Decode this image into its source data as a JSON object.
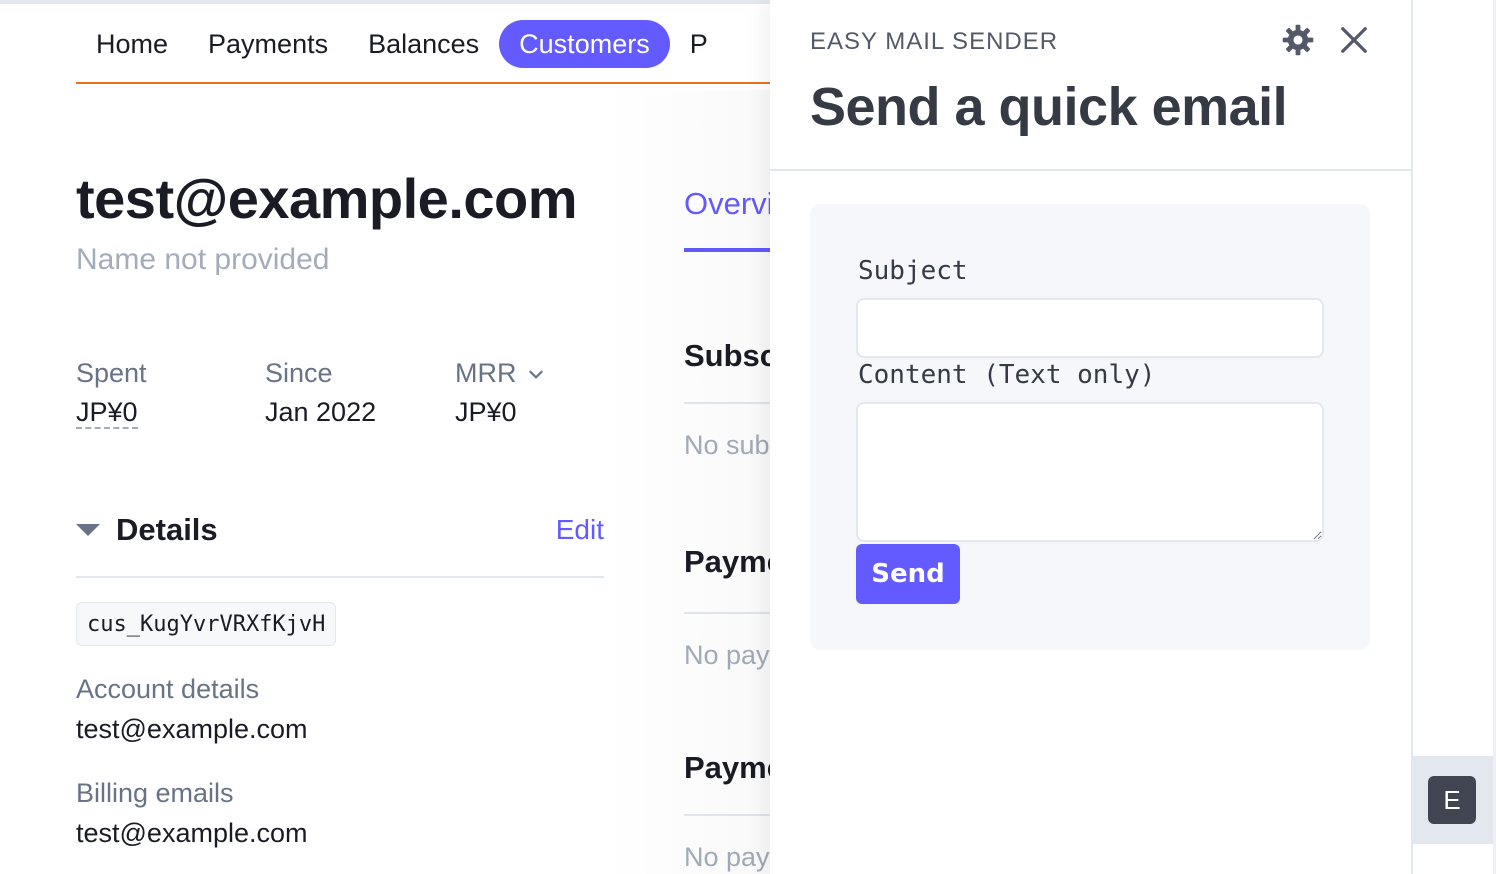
{
  "nav": {
    "items": [
      {
        "label": "Home",
        "active": false
      },
      {
        "label": "Payments",
        "active": false
      },
      {
        "label": "Balances",
        "active": false
      },
      {
        "label": "Customers",
        "active": true
      },
      {
        "label": "P",
        "active": false
      }
    ]
  },
  "customer": {
    "email": "test@example.com",
    "name": "Name not provided",
    "stats": [
      {
        "label": "Spent",
        "value": "JP¥0"
      },
      {
        "label": "Since",
        "value": "Jan 2022"
      },
      {
        "label": "MRR",
        "value": "JP¥0"
      }
    ],
    "details": {
      "title": "Details",
      "edit_label": "Edit",
      "id": "cus_KugYvrVRXfKjvH",
      "account_label": "Account details",
      "account_value": "test@example.com",
      "billing_label": "Billing emails",
      "billing_value": "test@example.com"
    }
  },
  "overview": {
    "tab_label": "Overview",
    "sections": [
      {
        "title": "Subscriptions",
        "empty": "No subscriptions"
      },
      {
        "title": "Payments",
        "empty": "No payments"
      },
      {
        "title": "Payment methods",
        "empty": "No payment methods"
      }
    ]
  },
  "drawer": {
    "app_name": "EASY MAIL SENDER",
    "title": "Send a quick email",
    "settings_icon": "gear-icon",
    "close_icon": "close-icon",
    "form": {
      "subject_label": "Subject",
      "subject_value": "",
      "content_label": "Content (Text only)",
      "content_value": "",
      "send_label": "Send"
    }
  },
  "rail": {
    "app_initial": "E"
  },
  "colors": {
    "accent": "#635bff",
    "nav_rule": "#e8731d",
    "muted_text": "#687385",
    "placeholder_text": "#a3acba",
    "drawer_title": "#353a44",
    "form_card_bg": "#f5f7fa",
    "rail_app_bg": "#414552"
  }
}
